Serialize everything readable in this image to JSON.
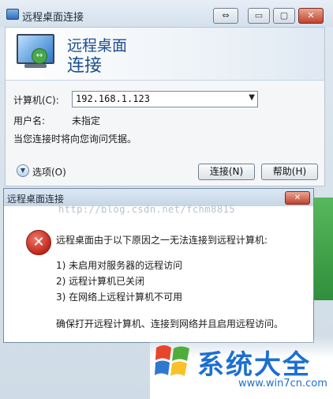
{
  "window": {
    "title": "远程桌面连接",
    "header_line1": "远程桌面",
    "header_line2": "连接",
    "computer_label": "计算机(C):",
    "computer_value": "192.168.1.123",
    "username_label": "用户名:",
    "username_value": "未指定",
    "hint": "当您连接时将向您询问凭据。",
    "options_label": "选项(O)",
    "connect_label": "连接(N)",
    "help_label": "帮助(H)",
    "buttons": {
      "swap": "⇔",
      "minimize": "▭",
      "maximize": "▢",
      "close": "✕"
    }
  },
  "dialog": {
    "title": "远程桌面连接",
    "close_label": "✕",
    "message": "远程桌面由于以下原因之一无法连接到远程计算机:",
    "reasons": [
      "1) 未启用对服务器的远程访问",
      "2) 远程计算机已关闭",
      "3) 在网络上远程计算机不可用"
    ],
    "advice": "确保打开远程计算机、连接到网络并且启用远程访问。"
  },
  "watermark": "http://blog.csdn.net/fchm8815",
  "logo": {
    "text": "系统大全",
    "url": "www.win7cn.com"
  },
  "colors": {
    "accent_blue": "#1d4f8e",
    "logo_blue": "#1d6fd0",
    "error_red": "#c0251a"
  }
}
